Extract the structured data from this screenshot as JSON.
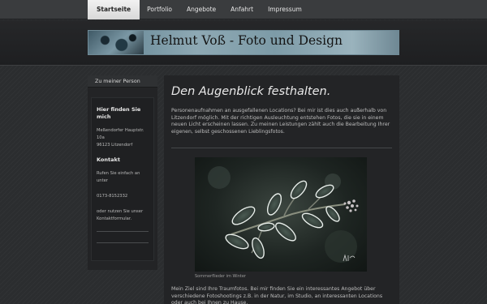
{
  "nav": {
    "items": [
      {
        "label": "Startseite",
        "active": true
      },
      {
        "label": "Portfolio",
        "active": false
      },
      {
        "label": "Angebote",
        "active": false
      },
      {
        "label": "Anfahrt",
        "active": false
      },
      {
        "label": "Impressum",
        "active": false
      }
    ]
  },
  "header": {
    "title": "Helmut Voß - Foto und Design"
  },
  "sidebar": {
    "link": "Zu meiner Person",
    "find_heading": "Hier finden Sie mich",
    "address_street": "Meßendorfer Hauptstr. 10a",
    "address_city": "96123 Litzendorf",
    "contact_heading": "Kontakt",
    "contact_text": "Rufen Sie einfach an unter",
    "phone": "0173-8152332",
    "form_text": "oder nutzen Sie unser Kontaktformular."
  },
  "main": {
    "title": "Den Augenblick festhalten.",
    "intro": "Personenaufnahmen an ausgefallenen Locations? Bei mir ist dies auch außerhalb von Litzendorf möglich. Mit der richtigen Ausleuchtung entstehen Fotos, die sie in einem neuen Licht erscheinen lassen. Zu meinen Leistungen zählt auch die Bearbeitung Ihrer eigenen, selbst geschossenen Lieblingsfotos.",
    "photo_caption": "Sommerflieder im Winter",
    "outro": "Mein Ziel sind Ihre Traumfotos. Bei mir finden Sie ein interessantes Angebot über verschiedene Fotoshootings z.B. in der Natur, im Studio, an interessanten Locations oder auch bei Ihnen zu Hause."
  },
  "colors": {
    "page_bg": "#2b2d2f",
    "nav_bg": "#3a3c3e",
    "active_tab": "#e6e6e6",
    "panel_bg": "#232426",
    "banner_accent": "#7d9ba7"
  }
}
